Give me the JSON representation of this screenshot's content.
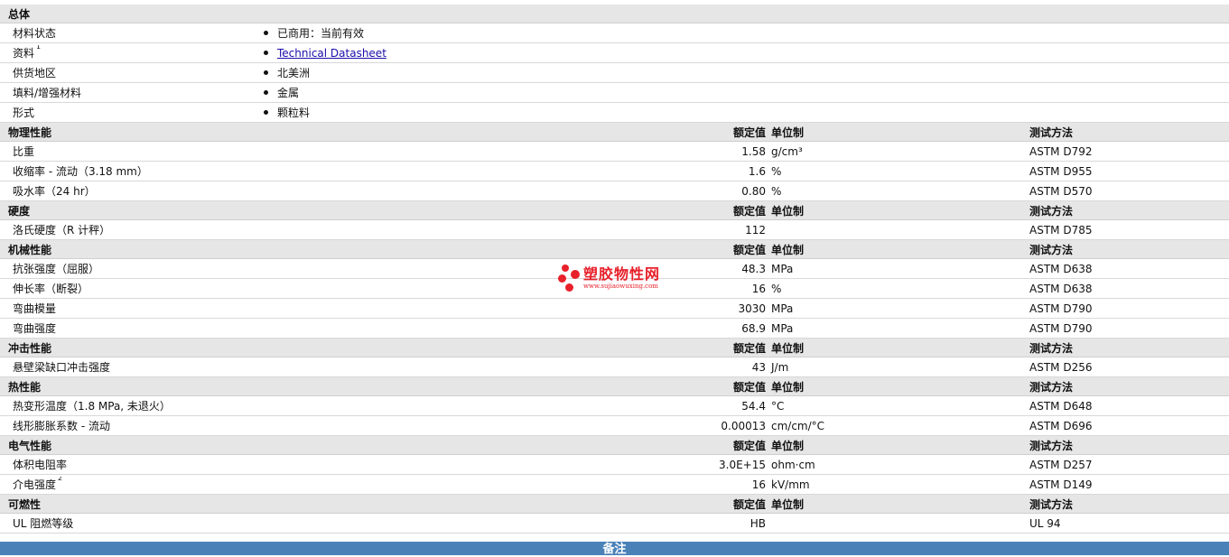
{
  "general": {
    "title": "总体",
    "rows": [
      {
        "label": "材料状态",
        "value": "已商用：当前有效"
      },
      {
        "label": "资料",
        "sup": "1",
        "value": "Technical Datasheet",
        "link": true
      },
      {
        "label": "供货地区",
        "value": "北美洲"
      },
      {
        "label": "填料/增强材料",
        "value": "金属"
      },
      {
        "label": "形式",
        "value": "颗粒料"
      }
    ]
  },
  "column_headers": {
    "nominal": "额定值",
    "unit": "单位制",
    "test": "测试方法"
  },
  "sections": [
    {
      "title": "物理性能",
      "rows": [
        {
          "name": "比重",
          "value": "1.58",
          "unit": "g/cm³",
          "test": "ASTM D792"
        },
        {
          "name": "收缩率  - 流动（3.18 mm）",
          "value": "1.6",
          "unit": "%",
          "test": "ASTM D955"
        },
        {
          "name": "吸水率（24 hr）",
          "value": "0.80",
          "unit": "%",
          "test": "ASTM D570"
        }
      ]
    },
    {
      "title": "硬度",
      "rows": [
        {
          "name": "洛氏硬度（R 计秤）",
          "value": "112",
          "unit": "",
          "test": "ASTM D785"
        }
      ]
    },
    {
      "title": "机械性能",
      "rows": [
        {
          "name": "抗张强度（屈服）",
          "value": "48.3",
          "unit": "MPa",
          "test": "ASTM D638"
        },
        {
          "name": "伸长率（断裂）",
          "value": "16",
          "unit": "%",
          "test": "ASTM D638"
        },
        {
          "name": "弯曲模量",
          "value": "3030",
          "unit": "MPa",
          "test": "ASTM D790"
        },
        {
          "name": "弯曲强度",
          "value": "68.9",
          "unit": "MPa",
          "test": "ASTM D790"
        }
      ]
    },
    {
      "title": "冲击性能",
      "rows": [
        {
          "name": "悬壁梁缺口冲击强度",
          "value": "43",
          "unit": "J/m",
          "test": "ASTM D256"
        }
      ]
    },
    {
      "title": "热性能",
      "rows": [
        {
          "name": "热变形温度（1.8 MPa, 未退火）",
          "value": "54.4",
          "unit": "°C",
          "test": "ASTM D648"
        },
        {
          "name": "线形膨胀系数  - 流动",
          "value": "0.00013",
          "unit": "cm/cm/°C",
          "test": "ASTM D696"
        }
      ]
    },
    {
      "title": "电气性能",
      "rows": [
        {
          "name": "体积电阻率",
          "value": "3.0E+15",
          "unit": "ohm·cm",
          "test": "ASTM D257"
        },
        {
          "name": "介电强度",
          "sup": "2",
          "value": "16",
          "unit": "kV/mm",
          "test": "ASTM D149"
        }
      ]
    },
    {
      "title": "可燃性",
      "rows": [
        {
          "name": "UL 阻燃等级",
          "value": "HB",
          "unit": "",
          "test": "UL 94"
        }
      ]
    }
  ],
  "footer": {
    "title": "备注"
  },
  "watermark": {
    "text": "塑胶物性网",
    "url": "www.sujiaowuxing.com"
  },
  "colors": {
    "header_bg": "#e6e6e6",
    "footer_bg": "#4a82b8",
    "watermark": "#e8202a",
    "link": "#1a0dab"
  }
}
